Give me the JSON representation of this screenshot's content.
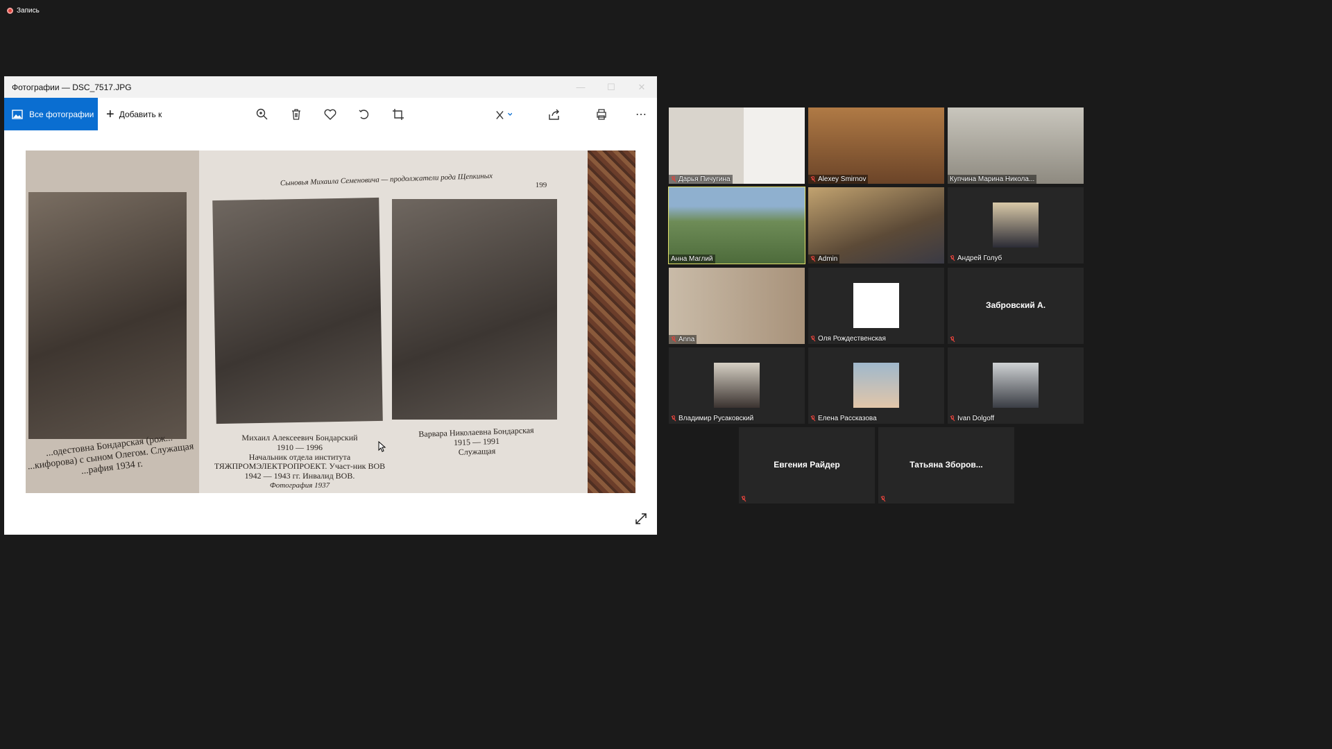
{
  "recording": {
    "label": "Запись"
  },
  "photos_window": {
    "title": "Фотографии — DSC_7517.JPG",
    "all_photos_label": "Все фотографии",
    "add_to_label": "Добавить к",
    "toolbar_icons": [
      "zoom-in-icon",
      "delete-icon",
      "favorite-icon",
      "rotate-icon",
      "crop-icon",
      "edit-icon",
      "share-icon",
      "print-icon",
      "more-icon"
    ],
    "book": {
      "header": "Сыновья Михаила Семеновича — продолжатели рода Щепкиных",
      "page_number": "199",
      "caption_left": "...одестовна Бондарская (рож... ...кифорова) с сыном Олегом. Служащая ...рафия 1934 г.",
      "caption_middle_name": "Михаил Алексеевич Бондарский",
      "caption_middle_years": "1910 — 1996",
      "caption_middle_text": "Начальник отдела института ТЯЖПРОМЭЛЕКТРОПРОЕКТ. Участ-ник ВОВ 1942 — 1943 гг. Инвалид ВОВ.",
      "caption_middle_photo": "Фотография 1937",
      "caption_right_name": "Варвара Николаевна Бондарская",
      "caption_right_years": "1915 — 1991",
      "caption_right_text": "Служащая"
    }
  },
  "participants": [
    {
      "name": "Дарья Пичугина",
      "muted": true,
      "kind": "video"
    },
    {
      "name": "Alexey Smirnov",
      "muted": true,
      "kind": "video"
    },
    {
      "name": "Купчина Марина Никола...",
      "muted": false,
      "kind": "video"
    },
    {
      "name": "Анна Маглий",
      "muted": false,
      "kind": "video",
      "active": true
    },
    {
      "name": "Admin",
      "muted": true,
      "kind": "video"
    },
    {
      "name": "Андрей Голуб",
      "muted": true,
      "kind": "avatar"
    },
    {
      "name": "Anna",
      "muted": true,
      "kind": "video"
    },
    {
      "name": "Оля Рождественская",
      "muted": true,
      "kind": "avatar"
    },
    {
      "name": "Забровский А.",
      "muted": true,
      "kind": "name-only"
    },
    {
      "name": "Владимир Русаковский",
      "muted": true,
      "kind": "avatar"
    },
    {
      "name": "Елена Рассказова",
      "muted": true,
      "kind": "avatar"
    },
    {
      "name": "Ivan Dolgoff",
      "muted": true,
      "kind": "avatar"
    },
    {
      "name": "Евгения Райдер",
      "muted": true,
      "kind": "name-only"
    },
    {
      "name": "Татьяна Зборов...",
      "muted": true,
      "kind": "name-only"
    }
  ],
  "colors": {
    "accent": "#0a6ed1",
    "active_speaker": "#e6e36a",
    "mute": "#e0433c"
  }
}
